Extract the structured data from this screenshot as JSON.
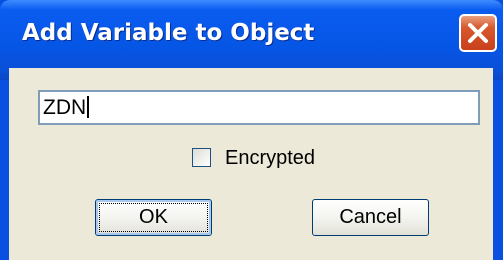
{
  "window": {
    "title": "Add Variable to Object"
  },
  "variable_input": {
    "value": "ZDN"
  },
  "encrypted_checkbox": {
    "label": "Encrypted",
    "checked": false
  },
  "buttons": {
    "ok_label": "OK",
    "cancel_label": "Cancel"
  },
  "icons": {
    "close": "close-icon"
  },
  "colors": {
    "titlebar": "#0656e6",
    "close_button": "#c8401c",
    "dialog_background": "#ece9d8"
  }
}
